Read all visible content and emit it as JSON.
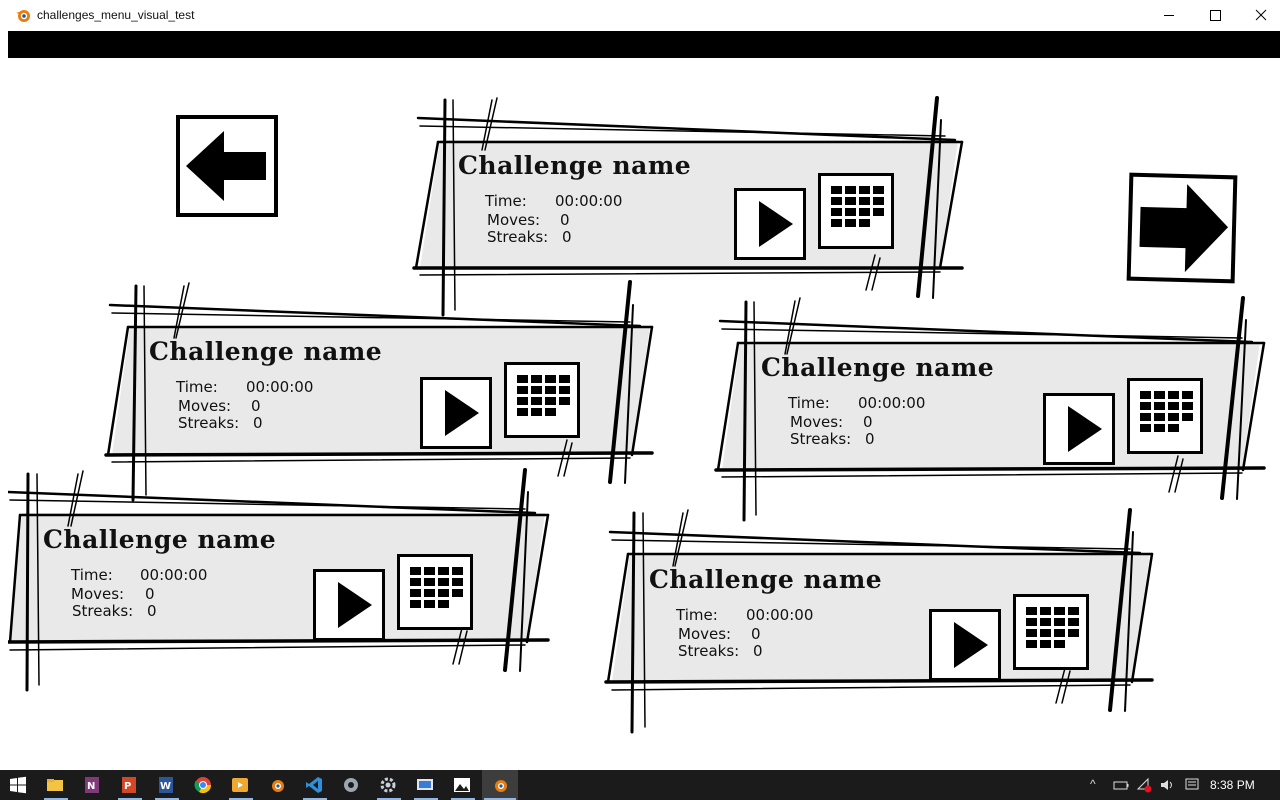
{
  "window": {
    "title": "challenges_menu_visual_test"
  },
  "nav": {
    "prev_icon": "arrow-left-icon",
    "next_icon": "arrow-right-icon"
  },
  "cards": [
    {
      "name": "Challenge name",
      "time_label": "Time:",
      "time": "00:00:00",
      "moves_label": "Moves:",
      "moves": "0",
      "streaks_label": "Streaks:",
      "streaks": "0"
    },
    {
      "name": "Challenge name",
      "time_label": "Time:",
      "time": "00:00:00",
      "moves_label": "Moves:",
      "moves": "0",
      "streaks_label": "Streaks:",
      "streaks": "0"
    },
    {
      "name": "Challenge name",
      "time_label": "Time:",
      "time": "00:00:00",
      "moves_label": "Moves:",
      "moves": "0",
      "streaks_label": "Streaks:",
      "streaks": "0"
    },
    {
      "name": "Challenge name",
      "time_label": "Time:",
      "time": "00:00:00",
      "moves_label": "Moves:",
      "moves": "0",
      "streaks_label": "Streaks:",
      "streaks": "0"
    },
    {
      "name": "Challenge name",
      "time_label": "Time:",
      "time": "00:00:00",
      "moves_label": "Moves:",
      "moves": "0",
      "streaks_label": "Streaks:",
      "streaks": "0"
    }
  ],
  "taskbar": {
    "apps": [
      "start-icon",
      "file-explorer-icon",
      "onenote-icon",
      "powerpoint-icon",
      "word-icon",
      "chrome-icon",
      "media-icon",
      "blender-icon",
      "vscode-icon",
      "app-icon",
      "settings-icon",
      "remote-desktop-icon",
      "photos-icon",
      "blender-active-icon"
    ],
    "clock": "8:38 PM"
  },
  "colors": {
    "panel": "#e9e9e9",
    "ink": "#000000",
    "taskbar": "#1b1b1b"
  }
}
